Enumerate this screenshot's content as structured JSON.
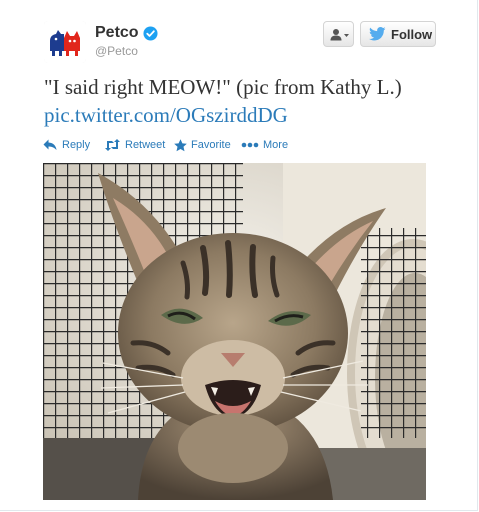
{
  "user": {
    "name": "Petco",
    "handle": "@Petco"
  },
  "buttons": {
    "follow_label": "Follow"
  },
  "tweet": {
    "text": "\"I said right MEOW!\" (pic from Kathy L.)",
    "link": "pic.twitter.com/OGszirddDG"
  },
  "actions": [
    {
      "label": "Reply",
      "icon": "reply-icon"
    },
    {
      "label": "Retweet",
      "icon": "retweet-icon"
    },
    {
      "label": "Favorite",
      "icon": "star-icon"
    },
    {
      "label": "More",
      "icon": "more-dots-icon"
    }
  ],
  "colors": {
    "link": "#2b7bb9",
    "verified": "#1da1f2",
    "logo_red": "#e1261c",
    "logo_blue": "#1d3c8f"
  }
}
